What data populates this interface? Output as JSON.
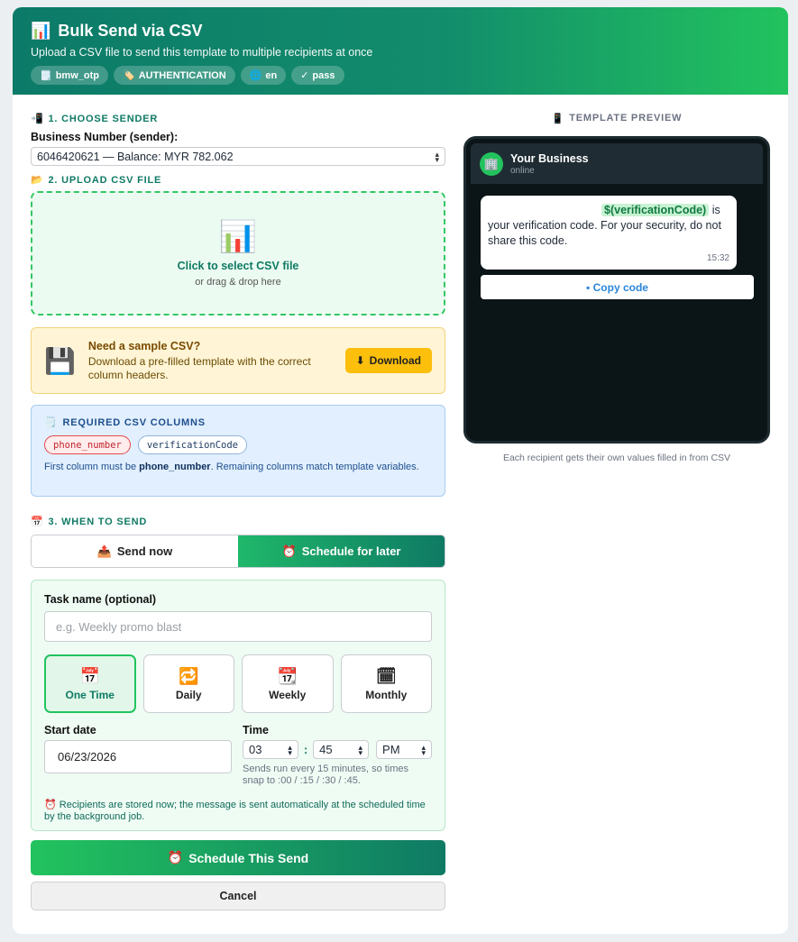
{
  "header": {
    "icon": "bar-chart-icon",
    "title": "Bulk Send via CSV",
    "subtitle": "Upload a CSV file to send this template to multiple recipients at once",
    "pills": [
      {
        "icon": "template-icon",
        "label": "bmw_otp"
      },
      {
        "icon": "ticket-icon",
        "label": "AUTHENTICATION"
      },
      {
        "icon": "globe-icon",
        "label": "en"
      },
      {
        "icon": "check-icon",
        "label": "pass"
      }
    ]
  },
  "sender": {
    "section_title": "1. CHOOSE SENDER",
    "field_label": "Business Number (sender):",
    "selected": "6046420621 — Balance: MYR 782.062"
  },
  "upload": {
    "section_title": "2. UPLOAD CSV FILE",
    "main_text": "Click to select CSV file",
    "sub_text": "or drag & drop here"
  },
  "sample": {
    "title": "Need a sample CSV?",
    "description": "Download a pre-filled template with the correct column headers.",
    "button_label": "Download"
  },
  "required": {
    "title": "REQUIRED CSV COLUMNS",
    "columns": [
      "phone_number",
      "verificationCode"
    ],
    "note_prefix": "First column must be ",
    "note_bold": "phone_number",
    "note_suffix": ". Remaining columns match template variables."
  },
  "when": {
    "section_title": "3. WHEN TO SEND",
    "send_now": "Send now",
    "schedule_later": "Schedule for later",
    "task_label": "Task name (optional)",
    "task_placeholder": "e.g. Weekly promo blast",
    "frequencies": [
      {
        "icon": "calendar-17-icon",
        "glyph": "📅",
        "label": "One Time",
        "active": true
      },
      {
        "icon": "repeat-icon",
        "glyph": "🔁",
        "label": "Daily",
        "active": false
      },
      {
        "icon": "calendar-week-icon",
        "glyph": "📆",
        "label": "Weekly",
        "active": false
      },
      {
        "icon": "calendar-month-icon",
        "glyph": "🗓",
        "label": "Monthly",
        "active": false
      }
    ],
    "start_date_label": "Start date",
    "start_date": "06/23/2026",
    "time_label": "Time",
    "hour": "03",
    "minute": "45",
    "ampm": "PM",
    "time_note": "Sends run every 15 minutes, so times snap to :00 / :15 / :30 / :45.",
    "schedule_note": "Recipients are stored now; the message is sent automatically at the scheduled time by the background job."
  },
  "actions": {
    "primary": "Schedule This Send",
    "cancel": "Cancel"
  },
  "preview": {
    "section_title": "TEMPLATE PREVIEW",
    "business_name": "Your Business",
    "status": "online",
    "variable": "$(verificationCode)",
    "body_after": "is your verification code. For your security, do not share this code.",
    "timestamp": "15:32",
    "copy_button": "Copy code",
    "caption": "Each recipient gets their own values filled in from CSV"
  },
  "colors": {
    "brand_green": "#22c35e",
    "brand_teal": "#0f7a64",
    "download_yellow": "#fbbf0c",
    "info_blue": "#e1efff"
  }
}
